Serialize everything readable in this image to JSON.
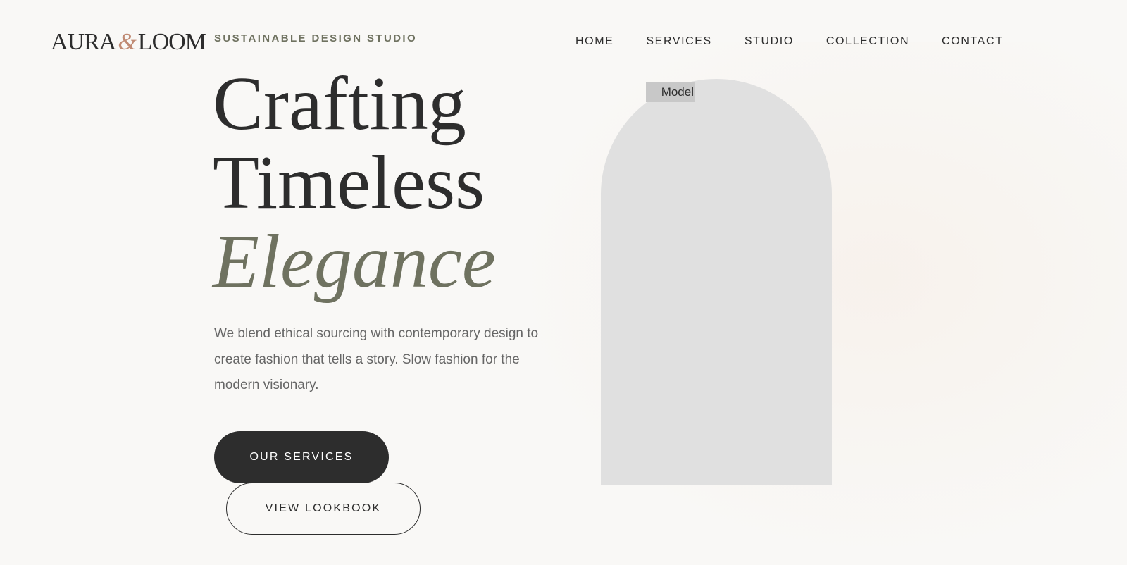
{
  "header": {
    "logo": {
      "part1": "AURA",
      "ampersand": "&",
      "part2": "LOOM"
    },
    "tagline": "SUSTAINABLE DESIGN STUDIO",
    "nav": [
      {
        "label": "HOME"
      },
      {
        "label": "SERVICES"
      },
      {
        "label": "STUDIO"
      },
      {
        "label": "COLLECTION"
      },
      {
        "label": "CONTACT"
      }
    ]
  },
  "hero": {
    "headline": {
      "line1": "Crafting",
      "line2": "Timeless",
      "line3": "Elegance"
    },
    "description": "We blend ethical sourcing with contemporary design to create fashion that tells a story. Slow fashion for the modern visionary.",
    "primary_button": "OUR SERVICES",
    "secondary_button": "VIEW LOOKBOOK",
    "image_alt": "Model"
  },
  "colors": {
    "text": "#2d2d2d",
    "accent": "#6f7260",
    "ampersand": "#c08a73",
    "background": "#f9f8f6",
    "image_placeholder": "#e0e0e0"
  }
}
